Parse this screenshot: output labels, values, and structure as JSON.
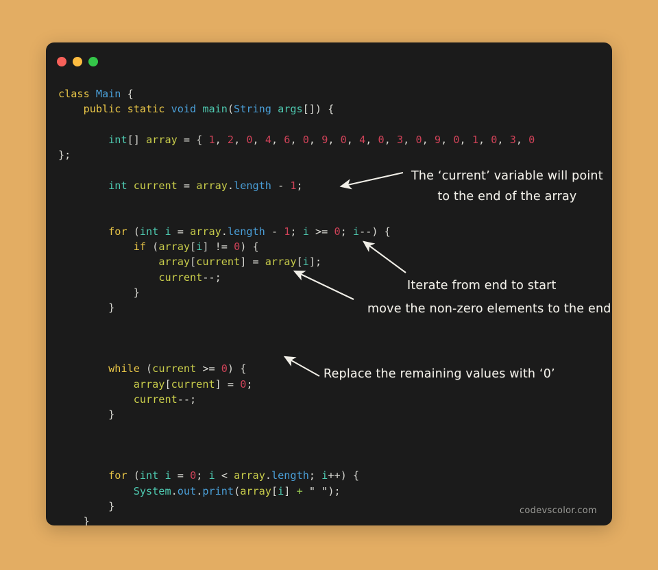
{
  "window": {
    "background_color": "#e3ad63",
    "surface_color": "#1b1b1b",
    "traffic_lights": [
      {
        "name": "close",
        "color": "#f8615a"
      },
      {
        "name": "minimize",
        "color": "#fdbc40"
      },
      {
        "name": "maximize",
        "color": "#34c749"
      }
    ]
  },
  "code": {
    "language": "java",
    "lines": [
      [
        {
          "t": "class ",
          "c": "kw"
        },
        {
          "t": "Main",
          "c": "cls"
        },
        {
          "t": " {",
          "c": "punc"
        }
      ],
      [
        {
          "t": "    ",
          "c": "punc"
        },
        {
          "t": "public static ",
          "c": "kw"
        },
        {
          "t": "void ",
          "c": "cls"
        },
        {
          "t": "main",
          "c": "type"
        },
        {
          "t": "(",
          "c": "punc"
        },
        {
          "t": "String ",
          "c": "cls"
        },
        {
          "t": "args",
          "c": "type"
        },
        {
          "t": "[]) {",
          "c": "punc"
        }
      ],
      [
        {
          "t": "",
          "c": "punc"
        }
      ],
      [
        {
          "t": "        ",
          "c": "punc"
        },
        {
          "t": "int",
          "c": "type"
        },
        {
          "t": "[] ",
          "c": "punc"
        },
        {
          "t": "array",
          "c": "ident"
        },
        {
          "t": " = { ",
          "c": "punc"
        },
        {
          "t": "1",
          "c": "num"
        },
        {
          "t": ", ",
          "c": "punc"
        },
        {
          "t": "2",
          "c": "num"
        },
        {
          "t": ", ",
          "c": "punc"
        },
        {
          "t": "0",
          "c": "num"
        },
        {
          "t": ", ",
          "c": "punc"
        },
        {
          "t": "4",
          "c": "num"
        },
        {
          "t": ", ",
          "c": "punc"
        },
        {
          "t": "6",
          "c": "num"
        },
        {
          "t": ", ",
          "c": "punc"
        },
        {
          "t": "0",
          "c": "num"
        },
        {
          "t": ", ",
          "c": "punc"
        },
        {
          "t": "9",
          "c": "num"
        },
        {
          "t": ", ",
          "c": "punc"
        },
        {
          "t": "0",
          "c": "num"
        },
        {
          "t": ", ",
          "c": "punc"
        },
        {
          "t": "4",
          "c": "num"
        },
        {
          "t": ", ",
          "c": "punc"
        },
        {
          "t": "0",
          "c": "num"
        },
        {
          "t": ", ",
          "c": "punc"
        },
        {
          "t": "3",
          "c": "num"
        },
        {
          "t": ", ",
          "c": "punc"
        },
        {
          "t": "0",
          "c": "num"
        },
        {
          "t": ", ",
          "c": "punc"
        },
        {
          "t": "9",
          "c": "num"
        },
        {
          "t": ", ",
          "c": "punc"
        },
        {
          "t": "0",
          "c": "num"
        },
        {
          "t": ", ",
          "c": "punc"
        },
        {
          "t": "1",
          "c": "num"
        },
        {
          "t": ", ",
          "c": "punc"
        },
        {
          "t": "0",
          "c": "num"
        },
        {
          "t": ", ",
          "c": "punc"
        },
        {
          "t": "3",
          "c": "num"
        },
        {
          "t": ", ",
          "c": "punc"
        },
        {
          "t": "0",
          "c": "num"
        }
      ],
      [
        {
          "t": "};",
          "c": "punc"
        }
      ],
      [
        {
          "t": "",
          "c": "punc"
        }
      ],
      [
        {
          "t": "        ",
          "c": "punc"
        },
        {
          "t": "int",
          "c": "type"
        },
        {
          "t": " ",
          "c": "punc"
        },
        {
          "t": "current",
          "c": "ident"
        },
        {
          "t": " = ",
          "c": "punc"
        },
        {
          "t": "array",
          "c": "ident"
        },
        {
          "t": ".",
          "c": "punc"
        },
        {
          "t": "length",
          "c": "cls"
        },
        {
          "t": " - ",
          "c": "punc"
        },
        {
          "t": "1",
          "c": "num"
        },
        {
          "t": ";",
          "c": "punc"
        }
      ],
      [
        {
          "t": "",
          "c": "punc"
        }
      ],
      [
        {
          "t": "",
          "c": "punc"
        }
      ],
      [
        {
          "t": "        ",
          "c": "punc"
        },
        {
          "t": "for",
          "c": "kw"
        },
        {
          "t": " (",
          "c": "punc"
        },
        {
          "t": "int",
          "c": "type"
        },
        {
          "t": " ",
          "c": "punc"
        },
        {
          "t": "i",
          "c": "var"
        },
        {
          "t": " = ",
          "c": "punc"
        },
        {
          "t": "array",
          "c": "ident"
        },
        {
          "t": ".",
          "c": "punc"
        },
        {
          "t": "length",
          "c": "cls"
        },
        {
          "t": " - ",
          "c": "punc"
        },
        {
          "t": "1",
          "c": "num"
        },
        {
          "t": "; ",
          "c": "punc"
        },
        {
          "t": "i",
          "c": "var"
        },
        {
          "t": " >= ",
          "c": "punc"
        },
        {
          "t": "0",
          "c": "num"
        },
        {
          "t": "; ",
          "c": "punc"
        },
        {
          "t": "i",
          "c": "var"
        },
        {
          "t": "--) {",
          "c": "punc"
        }
      ],
      [
        {
          "t": "            ",
          "c": "punc"
        },
        {
          "t": "if",
          "c": "kw"
        },
        {
          "t": " (",
          "c": "punc"
        },
        {
          "t": "array",
          "c": "ident"
        },
        {
          "t": "[",
          "c": "punc"
        },
        {
          "t": "i",
          "c": "var"
        },
        {
          "t": "] != ",
          "c": "punc"
        },
        {
          "t": "0",
          "c": "num"
        },
        {
          "t": ") {",
          "c": "punc"
        }
      ],
      [
        {
          "t": "                ",
          "c": "punc"
        },
        {
          "t": "array",
          "c": "ident"
        },
        {
          "t": "[",
          "c": "punc"
        },
        {
          "t": "current",
          "c": "ident"
        },
        {
          "t": "] = ",
          "c": "punc"
        },
        {
          "t": "array",
          "c": "ident"
        },
        {
          "t": "[",
          "c": "punc"
        },
        {
          "t": "i",
          "c": "var"
        },
        {
          "t": "];",
          "c": "punc"
        }
      ],
      [
        {
          "t": "                ",
          "c": "punc"
        },
        {
          "t": "current",
          "c": "ident"
        },
        {
          "t": "--;",
          "c": "punc"
        }
      ],
      [
        {
          "t": "            }",
          "c": "punc"
        }
      ],
      [
        {
          "t": "        }",
          "c": "punc"
        }
      ],
      [
        {
          "t": "",
          "c": "punc"
        }
      ],
      [
        {
          "t": "",
          "c": "punc"
        }
      ],
      [
        {
          "t": "",
          "c": "punc"
        }
      ],
      [
        {
          "t": "        ",
          "c": "punc"
        },
        {
          "t": "while",
          "c": "kw"
        },
        {
          "t": " (",
          "c": "punc"
        },
        {
          "t": "current",
          "c": "ident"
        },
        {
          "t": " >= ",
          "c": "punc"
        },
        {
          "t": "0",
          "c": "num"
        },
        {
          "t": ") {",
          "c": "punc"
        }
      ],
      [
        {
          "t": "            ",
          "c": "punc"
        },
        {
          "t": "array",
          "c": "ident"
        },
        {
          "t": "[",
          "c": "punc"
        },
        {
          "t": "current",
          "c": "ident"
        },
        {
          "t": "] = ",
          "c": "punc"
        },
        {
          "t": "0",
          "c": "num"
        },
        {
          "t": ";",
          "c": "punc"
        }
      ],
      [
        {
          "t": "            ",
          "c": "punc"
        },
        {
          "t": "current",
          "c": "ident"
        },
        {
          "t": "--;",
          "c": "punc"
        }
      ],
      [
        {
          "t": "        }",
          "c": "punc"
        }
      ],
      [
        {
          "t": "",
          "c": "punc"
        }
      ],
      [
        {
          "t": "",
          "c": "punc"
        }
      ],
      [
        {
          "t": "",
          "c": "punc"
        }
      ],
      [
        {
          "t": "        ",
          "c": "punc"
        },
        {
          "t": "for",
          "c": "kw"
        },
        {
          "t": " (",
          "c": "punc"
        },
        {
          "t": "int",
          "c": "type"
        },
        {
          "t": " ",
          "c": "punc"
        },
        {
          "t": "i",
          "c": "var"
        },
        {
          "t": " = ",
          "c": "punc"
        },
        {
          "t": "0",
          "c": "num"
        },
        {
          "t": "; ",
          "c": "punc"
        },
        {
          "t": "i",
          "c": "var"
        },
        {
          "t": " < ",
          "c": "punc"
        },
        {
          "t": "array",
          "c": "ident"
        },
        {
          "t": ".",
          "c": "punc"
        },
        {
          "t": "length",
          "c": "cls"
        },
        {
          "t": "; ",
          "c": "punc"
        },
        {
          "t": "i",
          "c": "var"
        },
        {
          "t": "++) {",
          "c": "punc"
        }
      ],
      [
        {
          "t": "            ",
          "c": "punc"
        },
        {
          "t": "System",
          "c": "type"
        },
        {
          "t": ".",
          "c": "punc"
        },
        {
          "t": "out",
          "c": "cls"
        },
        {
          "t": ".",
          "c": "punc"
        },
        {
          "t": "print",
          "c": "cls"
        },
        {
          "t": "(",
          "c": "punc"
        },
        {
          "t": "array",
          "c": "ident"
        },
        {
          "t": "[",
          "c": "punc"
        },
        {
          "t": "i",
          "c": "var"
        },
        {
          "t": "] ",
          "c": "punc"
        },
        {
          "t": "+",
          "c": "opg"
        },
        {
          "t": " ",
          "c": "punc"
        },
        {
          "t": "\" \"",
          "c": "str"
        },
        {
          "t": ");",
          "c": "punc"
        }
      ],
      [
        {
          "t": "        }",
          "c": "punc"
        }
      ],
      [
        {
          "t": "    }",
          "c": "punc"
        }
      ],
      [
        {
          "t": "}",
          "c": "punc"
        }
      ]
    ]
  },
  "annotations": [
    {
      "id": "annotation-current-variable",
      "line1": "The ‘current’ variable will point",
      "line2": "to the end of the array"
    },
    {
      "id": "annotation-iterate-loop",
      "line1": "Iterate from end to start",
      "line2": "move the non-zero elements to the end"
    },
    {
      "id": "annotation-replace-zero",
      "line1": "Replace the remaining values with ‘0’"
    }
  ],
  "watermark": {
    "text": "codevscolor.com"
  }
}
